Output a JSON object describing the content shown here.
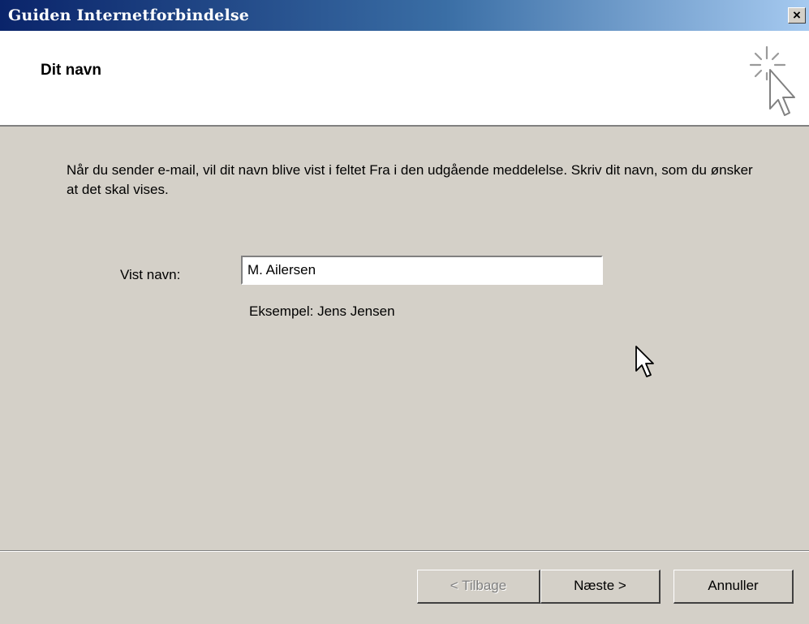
{
  "window": {
    "title": "Guiden Internetforbindelse",
    "close_label": "×"
  },
  "header": {
    "step_title": "Dit navn",
    "icon": "wizard-cursor-sparkle-icon"
  },
  "content": {
    "intro_text": "Når du sender e-mail, vil dit navn blive vist i feltet Fra i den udgående meddelelse. Skriv dit navn, som du ønsker at det skal vises.",
    "name_label": "Vist navn:",
    "name_value": "M. Ailersen",
    "example_text": "Eksempel: Jens Jensen"
  },
  "buttons": {
    "back_label": "< Tilbage",
    "back_enabled": false,
    "next_label": "Næste >",
    "cancel_label": "Annuller"
  },
  "colors": {
    "titlebar_start": "#0a246a",
    "titlebar_end": "#a6caf0",
    "dialog_face": "#d4d0c8"
  }
}
